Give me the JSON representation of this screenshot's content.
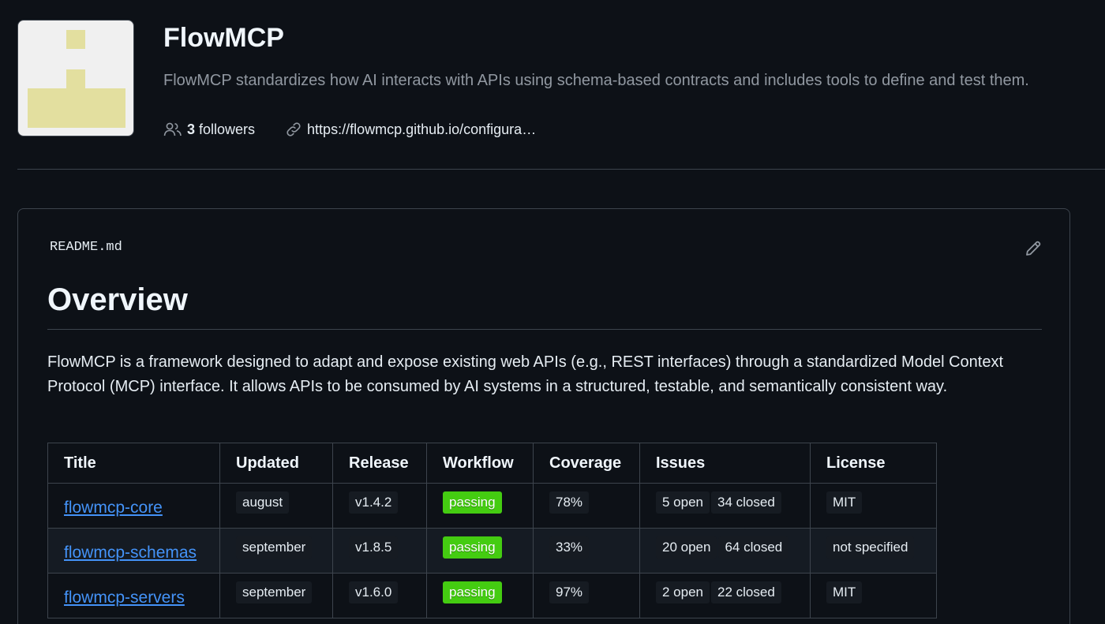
{
  "org": {
    "name": "FlowMCP",
    "description": "FlowMCP standardizes how AI interacts with APIs using schema-based contracts and includes tools to define and test them.",
    "followers_count": "3",
    "followers_label": "followers",
    "website": "https://flowmcp.github.io/configura…",
    "avatar_color": "#e3df9f"
  },
  "readme": {
    "filename": "README.md",
    "heading": "Overview",
    "paragraph": "FlowMCP is a framework designed to adapt and expose existing web APIs (e.g., REST interfaces) through a standardized Model Context Protocol (MCP) interface. It allows APIs to be consumed by AI systems in a structured, testable, and semantically consistent way.",
    "table": {
      "headers": [
        "Title",
        "Updated",
        "Release",
        "Workflow",
        "Coverage",
        "Issues",
        "License"
      ],
      "rows": [
        {
          "title": "flowmcp-core",
          "updated": "august",
          "release": "v1.4.2",
          "workflow": "passing",
          "coverage": "78%",
          "issues_open": "5 open",
          "issues_closed": "34 closed",
          "license": "MIT"
        },
        {
          "title": "flowmcp-schemas",
          "updated": "september",
          "release": "v1.8.5",
          "workflow": "passing",
          "coverage": "33%",
          "issues_open": "20 open",
          "issues_closed": "64 closed",
          "license": "not specified"
        },
        {
          "title": "flowmcp-servers",
          "updated": "september",
          "release": "v1.6.0",
          "workflow": "passing",
          "coverage": "97%",
          "issues_open": "2 open",
          "issues_closed": "22 closed",
          "license": "MIT"
        }
      ]
    }
  },
  "colors": {
    "background": "#0d1117",
    "link": "#4493f8",
    "passing": "#44cc11",
    "border": "#3d444d"
  },
  "icons": {
    "followers": "people-icon",
    "website": "link-icon",
    "edit": "pencil-icon"
  }
}
